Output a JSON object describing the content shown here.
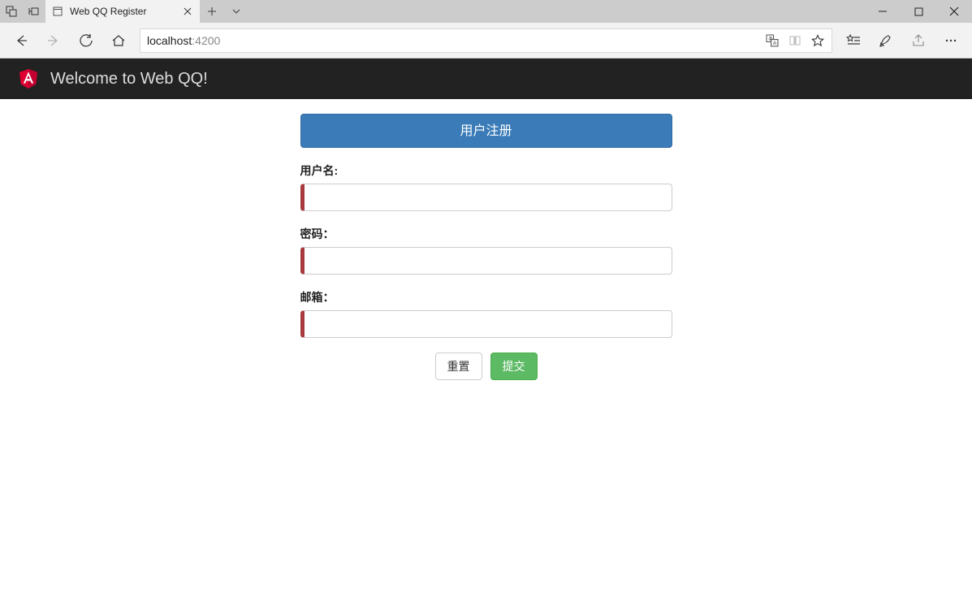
{
  "window": {
    "tab_title": "Web QQ Register"
  },
  "address": {
    "host": "localhost",
    "port": ":4200"
  },
  "app": {
    "title": "Welcome to Web QQ!"
  },
  "form": {
    "header": "用户注册",
    "username_label": "用户名:",
    "username_value": "",
    "password_label": "密码：",
    "password_value": "",
    "email_label": "邮箱：",
    "email_value": "",
    "reset_label": "重置",
    "submit_label": "提交"
  }
}
